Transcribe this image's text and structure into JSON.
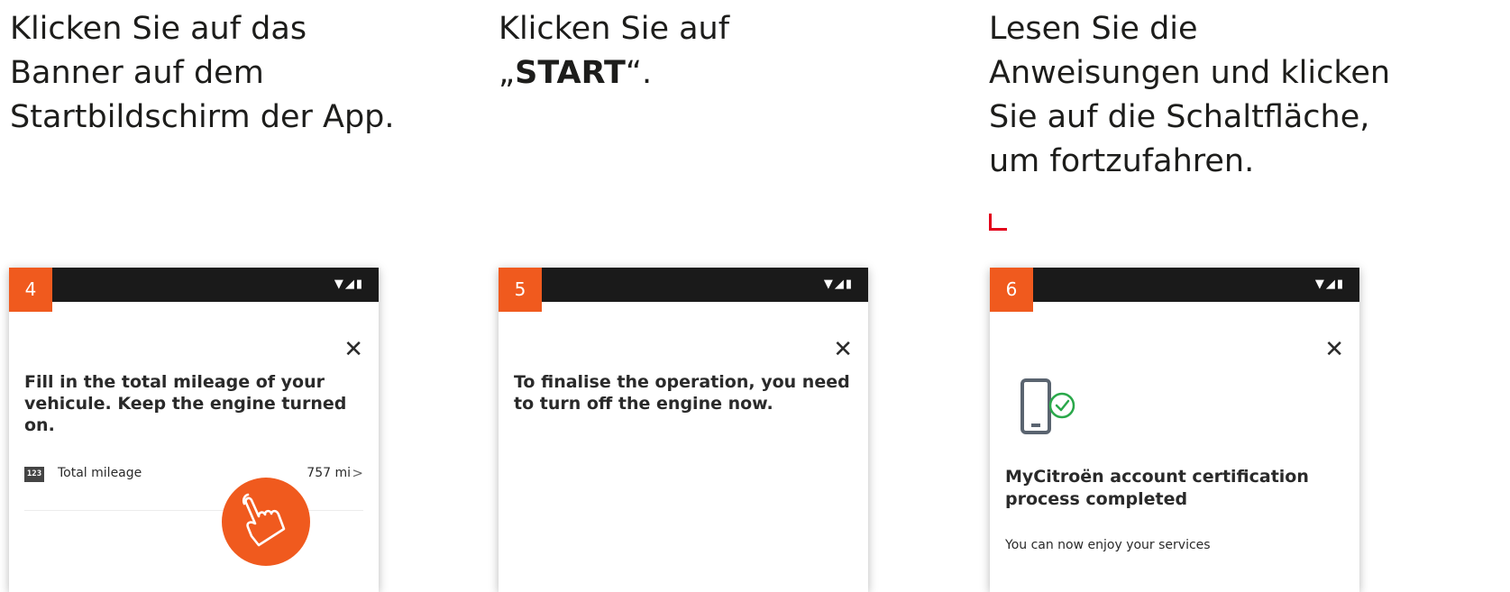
{
  "instructions": [
    {
      "lines": [
        "Klicken Sie auf das",
        "Banner auf dem",
        "Startbildschirm der App."
      ]
    },
    {
      "line1": "Klicken Sie auf",
      "quote_open": "„",
      "bold": "START",
      "quote_close": "“."
    },
    {
      "lines": [
        "Lesen Sie die",
        "Anweisungen und klicken",
        "Sie auf die Schaltfläche,",
        "um fortzufahren."
      ]
    }
  ],
  "screens": [
    {
      "step": "4",
      "status_icons": "▼◢▮",
      "close": "✕",
      "heading": "Fill in the total mileage of your vehicule. Keep the engine turned on.",
      "mileage_icon_text": "123",
      "mileage_label": "Total mileage",
      "mileage_value": "757 mi",
      "mileage_chevron": ">"
    },
    {
      "step": "5",
      "status_icons": "▼◢▮",
      "close": "✕",
      "heading": "To finalise the operation, you need to turn off the engine now."
    },
    {
      "step": "6",
      "status_icons": "▼◢▮",
      "close": "✕",
      "title": "MyCitroën account certification process completed",
      "subtitle": "You can now enjoy your services"
    }
  ],
  "colors": {
    "accent_orange": "#f05a1e",
    "corner_red": "#e2001a",
    "status_bar": "#1a1a1a",
    "check_green": "#2aa84a",
    "device_gray": "#5a6470"
  },
  "icons": {
    "tap": "hand-pointer-icon",
    "device": "smartphone-check-icon",
    "close": "close-icon",
    "chevron": "chevron-right-icon",
    "mileage": "odometer-icon"
  }
}
